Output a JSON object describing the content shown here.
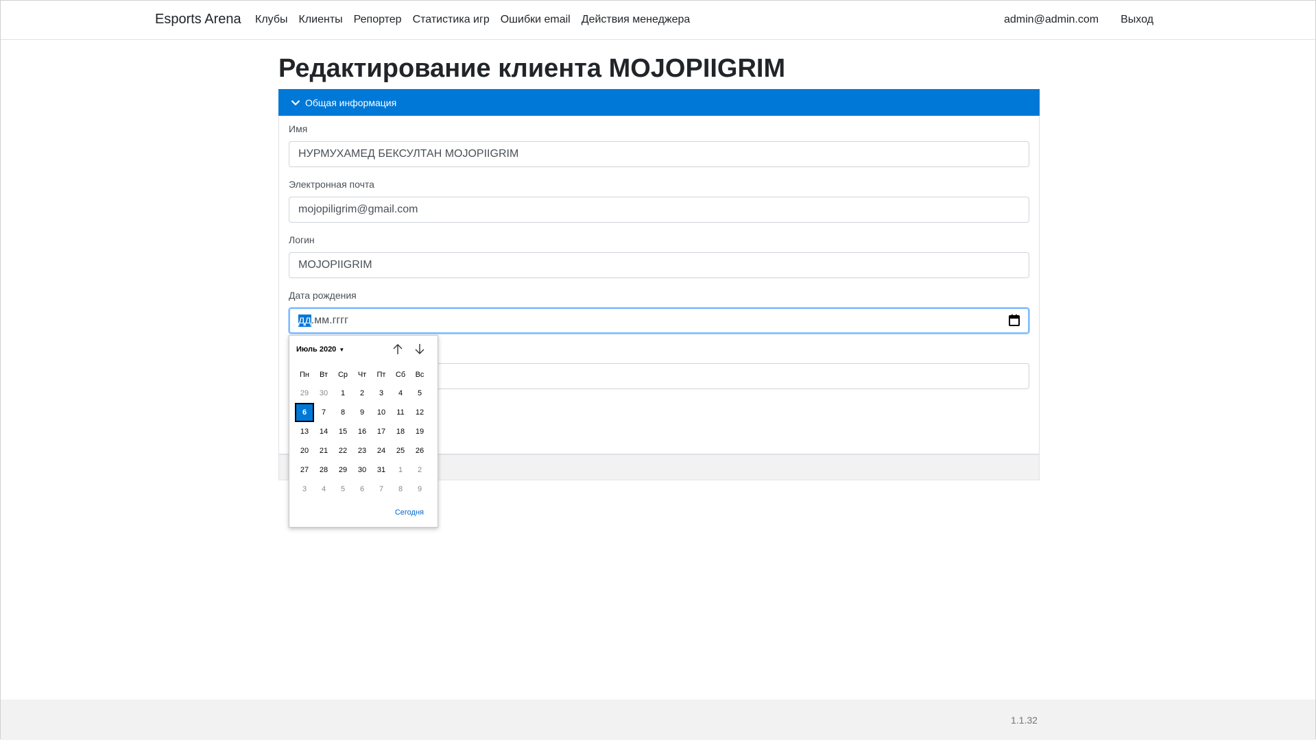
{
  "navbar": {
    "brand": "Esports Arena",
    "links": [
      "Клубы",
      "Клиенты",
      "Репортер",
      "Статистика игр",
      "Ошибки email",
      "Действия менеджера"
    ],
    "user": "admin@admin.com",
    "logout": "Выход"
  },
  "page": {
    "title": "Редактирование клиента MOJOPIIGRIM"
  },
  "section": {
    "title": "Общая информация",
    "accent_color": "#0078d7"
  },
  "form": {
    "name_label": "Имя",
    "name_value": "НУРМУХАМЕД БЕКСУЛТАН MOJOPIIGRIM",
    "email_label": "Электронная почта",
    "email_value": "mojopiligrim@gmail.com",
    "login_label": "Логин",
    "login_value": "MOJOPIIGRIM",
    "birth_label": "Дата рождения",
    "birth_placeholder_day": "дд",
    "birth_placeholder_rest": ".мм.гггг",
    "extra_value": ""
  },
  "datepicker": {
    "month_label": "Июль 2020",
    "weekdays": [
      "Пн",
      "Вт",
      "Ср",
      "Чт",
      "Пт",
      "Сб",
      "Вс"
    ],
    "weeks": [
      [
        "29",
        "30",
        "1",
        "2",
        "3",
        "4",
        "5"
      ],
      [
        "6",
        "7",
        "8",
        "9",
        "10",
        "11",
        "12"
      ],
      [
        "13",
        "14",
        "15",
        "16",
        "17",
        "18",
        "19"
      ],
      [
        "20",
        "21",
        "22",
        "23",
        "24",
        "25",
        "26"
      ],
      [
        "27",
        "28",
        "29",
        "30",
        "31",
        "1",
        "2"
      ],
      [
        "3",
        "4",
        "5",
        "6",
        "7",
        "8",
        "9"
      ]
    ],
    "today_button": "Сегодня"
  },
  "footer": {
    "version": "1.1.32"
  }
}
